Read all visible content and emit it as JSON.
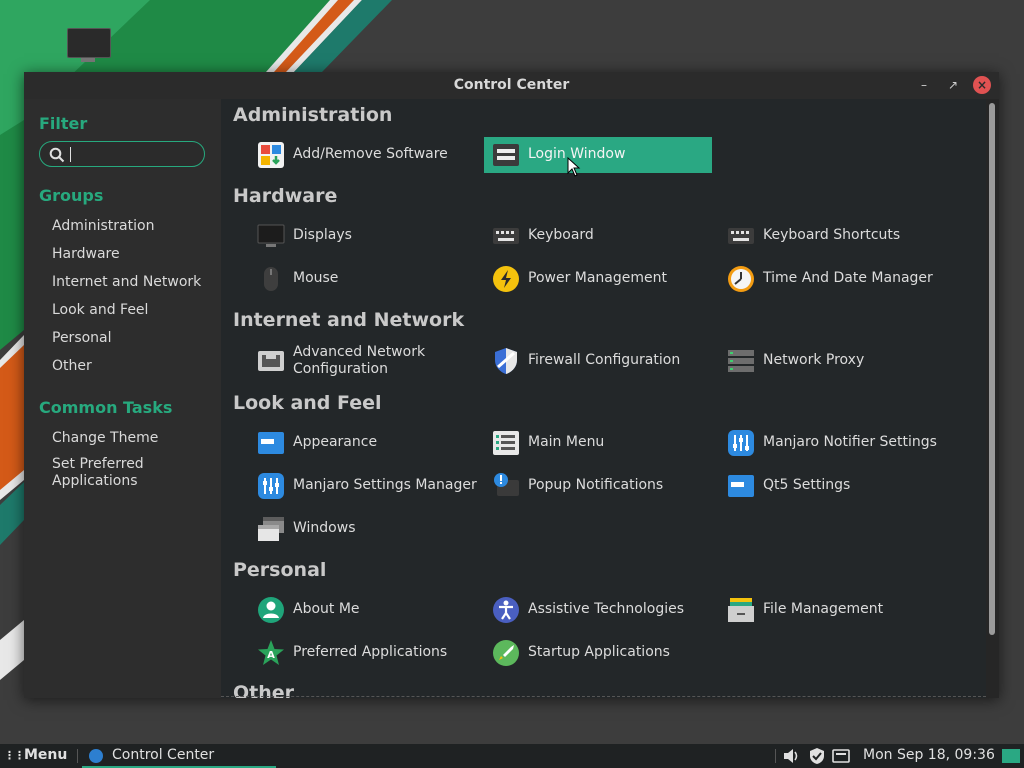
{
  "window": {
    "title": "Control Center"
  },
  "sidebar": {
    "filter_heading": "Filter",
    "search": {
      "value": "",
      "placeholder": ""
    },
    "groups_heading": "Groups",
    "groups": [
      "Administration",
      "Hardware",
      "Internet and Network",
      "Look and Feel",
      "Personal",
      "Other"
    ],
    "tasks_heading": "Common Tasks",
    "tasks": [
      "Change Theme",
      "Set Preferred Applications"
    ]
  },
  "sections": {
    "administration": {
      "title": "Administration",
      "items": [
        {
          "label": "Add/Remove Software",
          "icon": "package-icon"
        },
        {
          "label": "Login Window",
          "icon": "login-window-icon",
          "selected": true
        }
      ]
    },
    "hardware": {
      "title": "Hardware",
      "items": [
        {
          "label": "Displays",
          "icon": "monitor-icon"
        },
        {
          "label": "Keyboard",
          "icon": "keyboard-icon"
        },
        {
          "label": "Keyboard Shortcuts",
          "icon": "keyboard-shortcuts-icon"
        },
        {
          "label": "Mouse",
          "icon": "mouse-icon"
        },
        {
          "label": "Power Management",
          "icon": "power-icon"
        },
        {
          "label": "Time And Date Manager",
          "icon": "clock-icon"
        }
      ]
    },
    "internet": {
      "title": "Internet and Network",
      "items": [
        {
          "label": "Advanced Network Configuration",
          "icon": "network-port-icon"
        },
        {
          "label": "Firewall Configuration",
          "icon": "shield-icon"
        },
        {
          "label": "Network Proxy",
          "icon": "server-icon"
        }
      ]
    },
    "look": {
      "title": "Look and Feel",
      "items": [
        {
          "label": "Appearance",
          "icon": "appearance-icon"
        },
        {
          "label": "Main Menu",
          "icon": "menu-editor-icon"
        },
        {
          "label": "Manjaro Notifier Settings",
          "icon": "notifier-settings-icon"
        },
        {
          "label": "Manjaro Settings Manager",
          "icon": "settings-manager-icon"
        },
        {
          "label": "Popup Notifications",
          "icon": "notification-icon"
        },
        {
          "label": "Qt5 Settings",
          "icon": "qt5-settings-icon"
        },
        {
          "label": "Windows",
          "icon": "windows-icon"
        }
      ]
    },
    "personal": {
      "title": "Personal",
      "items": [
        {
          "label": "About Me",
          "icon": "user-icon"
        },
        {
          "label": "Assistive Technologies",
          "icon": "accessibility-icon"
        },
        {
          "label": "File Management",
          "icon": "file-cabinet-icon"
        },
        {
          "label": "Preferred Applications",
          "icon": "star-icon"
        },
        {
          "label": "Startup Applications",
          "icon": "rocket-icon"
        }
      ]
    },
    "other": {
      "title": "Other"
    }
  },
  "taskbar": {
    "menu_label": "Menu",
    "task_label": "Control Center",
    "clock": "Mon Sep 18, 09:36",
    "tray_icons": [
      "volume-icon",
      "shield-icon",
      "keyboard-icon"
    ]
  },
  "colors": {
    "accent": "#2aa883",
    "close": "#e05252"
  }
}
